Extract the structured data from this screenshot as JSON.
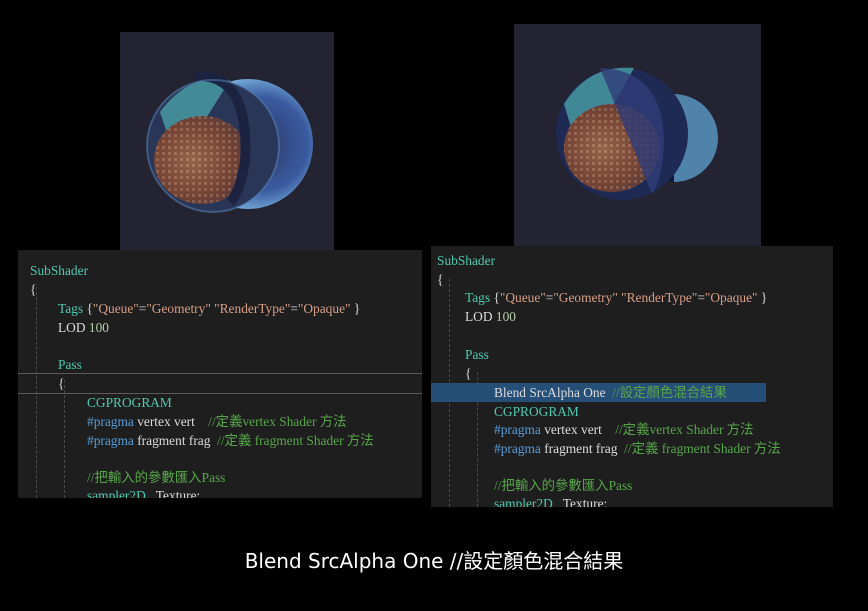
{
  "caption": "Blend SrcAlpha One  //設定顏色混合結果",
  "left_editor": {
    "lines": {
      "subshader": "SubShader",
      "brace1": "{",
      "tags_kw": "Tags",
      "tags_open": " {",
      "queue_k": "\"Queue\"",
      "eq1": "=",
      "queue_v": "\"Geometry\"",
      "rt_k": " \"RenderType\"",
      "eq2": "=",
      "rt_v": "\"Opaque\"",
      "tags_close": " }",
      "lod_kw": "LOD",
      "lod_v": " 100",
      "pass": "Pass",
      "brace2": "{",
      "cgprogram": "CGPROGRAM",
      "pragma1_kw": "#pragma",
      "pragma1_rest": " vertex vert    ",
      "pragma1_cm": "//定義vertex Shader 方法",
      "pragma2_kw": "#pragma",
      "pragma2_rest": " fragment frag  ",
      "pragma2_cm": "//定義 fragment Shader 方法",
      "comment3": "//把輸入的參數匯入Pass",
      "sampler_kw": "sampler2D",
      "sampler_rest": " _Texture;"
    }
  },
  "right_editor": {
    "lines": {
      "subshader": "SubShader",
      "brace1": "{",
      "tags_kw": "Tags",
      "tags_open": " {",
      "queue_k": "\"Queue\"",
      "eq1": "=",
      "queue_v": "\"Geometry\"",
      "rt_k": " \"RenderType\"",
      "eq2": "=",
      "rt_v": "\"Opaque\"",
      "tags_close": " }",
      "lod_kw": "LOD",
      "lod_v": " 100",
      "pass": "Pass",
      "brace2": "{",
      "blend": "Blend SrcAlpha One  ",
      "blend_cm": "//設定顏色混合結果",
      "cgprogram": "CGPROGRAM",
      "pragma1_kw": "#pragma",
      "pragma1_rest": " vertex vert    ",
      "pragma1_cm": "//定義vertex Shader 方法",
      "pragma2_kw": "#pragma",
      "pragma2_rest": " fragment frag  ",
      "pragma2_cm": "//定義 fragment Shader 方法",
      "comment3": "//把輸入的參數匯入Pass",
      "sampler_kw": "sampler2D",
      "sampler_rest": " _Texture;"
    }
  },
  "colors": {
    "background": "#000000",
    "preview_bg": "#232331",
    "editor_bg": "#1e1e1e",
    "keyword": "#4ec9b0",
    "string": "#d69d85",
    "comment": "#57a64a",
    "directive": "#569cd6",
    "selection": "#264f78"
  }
}
